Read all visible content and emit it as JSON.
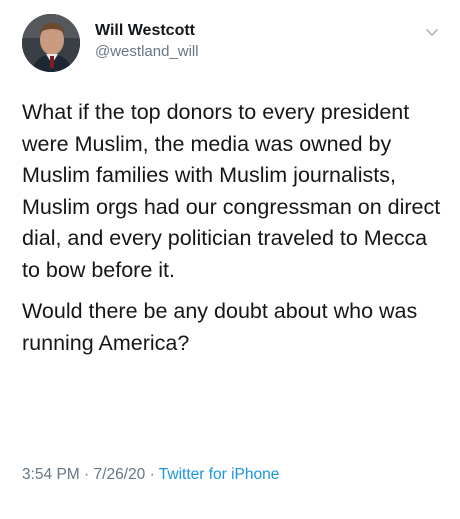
{
  "author": {
    "display_name": "Will Westcott",
    "handle": "@westland_will"
  },
  "icons": {
    "avatar": "profile-photo",
    "caret": "chevron-down-icon"
  },
  "tweet": {
    "paragraphs": [
      "What if the top donors to every president were Muslim, the media was owned by Muslim families with Muslim journalists, Muslim orgs had our congressman on direct dial, and every politician traveled to Mecca to bow before it.",
      "Would there be any doubt about who was running America?"
    ]
  },
  "meta": {
    "time": "3:54 PM",
    "separator": "·",
    "date": "7/26/20",
    "source": "Twitter for iPhone"
  },
  "colors": {
    "text": "#14171a",
    "secondary": "#657786",
    "link": "#1b95e0"
  }
}
